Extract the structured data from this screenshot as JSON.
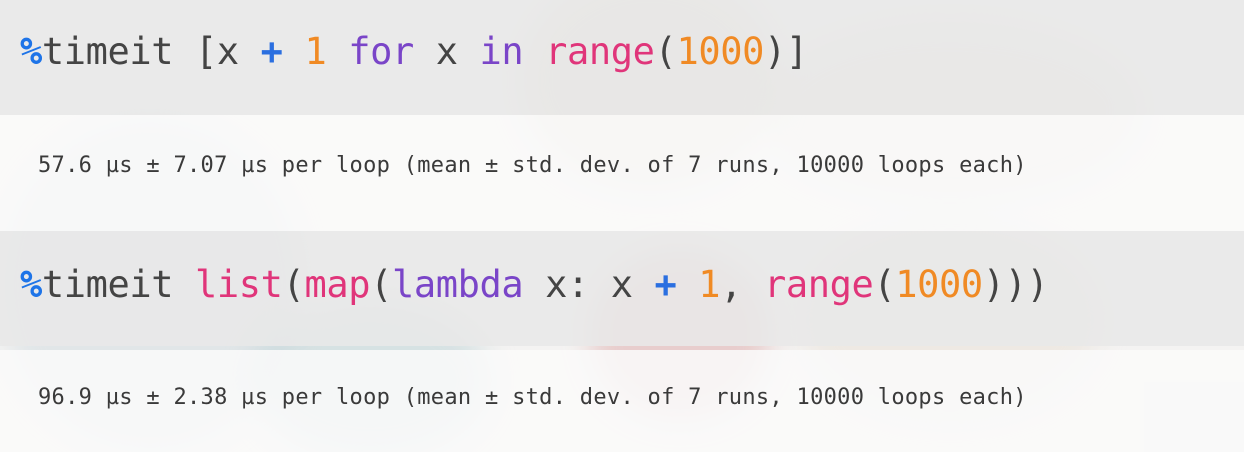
{
  "cells": [
    {
      "code_tokens": [
        {
          "t": "%",
          "c": "magic"
        },
        {
          "t": "timeit [x ",
          "c": "plain"
        },
        {
          "t": "+",
          "c": "op"
        },
        {
          "t": " ",
          "c": "plain"
        },
        {
          "t": "1",
          "c": "num"
        },
        {
          "t": " ",
          "c": "plain"
        },
        {
          "t": "for",
          "c": "kw"
        },
        {
          "t": " x ",
          "c": "plain"
        },
        {
          "t": "in",
          "c": "kw"
        },
        {
          "t": " ",
          "c": "plain"
        },
        {
          "t": "range",
          "c": "builtin"
        },
        {
          "t": "(",
          "c": "punc"
        },
        {
          "t": "1000",
          "c": "num"
        },
        {
          "t": ")]",
          "c": "punc"
        }
      ],
      "output": "57.6 µs ± 7.07 µs per loop (mean ± std. dev. of 7 runs, 10000 loops each)"
    },
    {
      "code_tokens": [
        {
          "t": "%",
          "c": "magic"
        },
        {
          "t": "timeit ",
          "c": "plain"
        },
        {
          "t": "list",
          "c": "builtin"
        },
        {
          "t": "(",
          "c": "punc"
        },
        {
          "t": "map",
          "c": "builtin"
        },
        {
          "t": "(",
          "c": "punc"
        },
        {
          "t": "lambda",
          "c": "kw"
        },
        {
          "t": " x: x ",
          "c": "plain"
        },
        {
          "t": "+",
          "c": "op"
        },
        {
          "t": " ",
          "c": "plain"
        },
        {
          "t": "1",
          "c": "num"
        },
        {
          "t": ", ",
          "c": "plain"
        },
        {
          "t": "range",
          "c": "builtin"
        },
        {
          "t": "(",
          "c": "punc"
        },
        {
          "t": "1000",
          "c": "num"
        },
        {
          "t": ")))",
          "c": "punc"
        }
      ],
      "output": "96.9 µs ± 2.38 µs per loop (mean ± std. dev. of 7 runs, 10000 loops each)"
    }
  ],
  "colors": {
    "magic": "#1e74e8",
    "keyword": "#7a45c8",
    "builtin": "#e0357a",
    "number": "#f08a24",
    "operator": "#2b6fe0",
    "text": "#444444"
  }
}
